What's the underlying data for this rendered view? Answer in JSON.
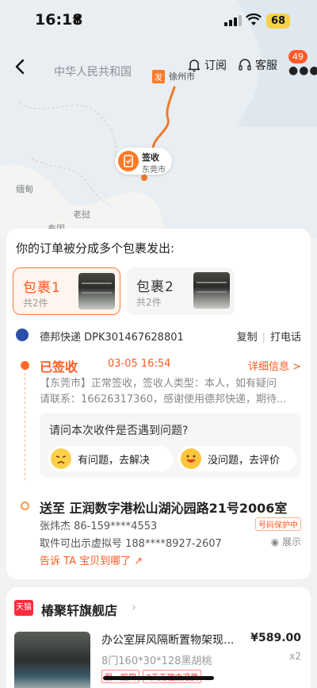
{
  "status_bar": {
    "time": "16:18",
    "battery": "68"
  },
  "map": {
    "country_label": "中华人民共和国",
    "labels": {
      "mandalay": "缅甸",
      "laos": "老挝",
      "thailand": "泰国"
    },
    "origin_tag": "发",
    "origin_city": "徐州市",
    "sign_status": "签收",
    "sign_city": "东莞市"
  },
  "header": {
    "subscribe_label": "订阅",
    "service_label": "客服",
    "badge": "49"
  },
  "order": {
    "split_title": "你的订单被分成多个包裹发出:",
    "packages": [
      {
        "name": "包裹1",
        "count": "共2件"
      },
      {
        "name": "包裹2",
        "count": "共2件"
      }
    ],
    "carrier": "德邦快递 DPK301467628801",
    "copy_label": "复制",
    "call_label": "打电话",
    "status_title": "已签收",
    "status_time": "03-05 16:54",
    "detail_label": "详细信息 >",
    "status_line1": "【东莞市】正常签收，签收人类型：本人，如有疑问",
    "status_line2": "请联系：16626317360，感谢使用德邦快递，期待...",
    "question": "请问本次收件是否遇到问题?",
    "option_problem": "有问题，去解决",
    "option_ok": "没问题，去评价",
    "address": "送至 正润数字港松山湖沁园路21号2006室",
    "contact": "张炜杰 86-159****4553",
    "privacy_tag": "号码保护中",
    "virtual_number": "取件可出示虚拟号 188****8927-2607",
    "show_label": "展示",
    "tell_label": "告诉 TA 宝贝到哪了"
  },
  "shop": {
    "platform": "天猫",
    "name": "椿聚轩旗舰店",
    "product_title": "办公室屏风隔断置物架现...",
    "price": "¥589.00",
    "spec": "8门160*30*128黑胡桃",
    "qty": "x2",
    "tags": [
      "假一赔四",
      "7天无理由退换"
    ]
  }
}
